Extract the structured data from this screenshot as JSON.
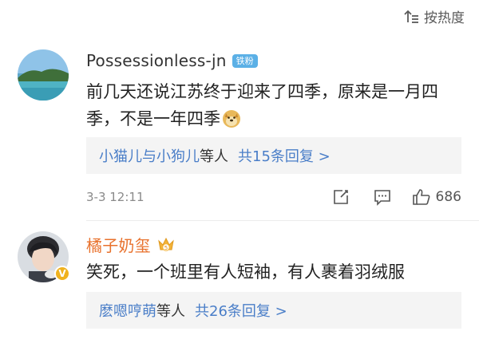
{
  "sort": {
    "label": "按热度",
    "icon": "sort-icon"
  },
  "comments": [
    {
      "username": "Possessionless-jn",
      "badge": "铁粉",
      "text": "前几天还说江苏终于迎来了四季，原来是一月四季，不是一年四季",
      "emoji": "doge-emoji",
      "replies": {
        "users": "小猫儿与小狗儿",
        "suffix": "等人",
        "count": "共15条回复 >"
      },
      "time": "3-3 12:11",
      "likes": "686"
    },
    {
      "username": "橘子奶玺",
      "badge_level": "5",
      "text": "笑死，一个班里有人短袖，有人裹着羽绒服",
      "replies": {
        "users": "麽嗯哼萌",
        "suffix": "等人",
        "count": "共26条回复 >"
      }
    }
  ],
  "colors": {
    "link": "#4a7ec8",
    "vip_name": "#e8712c",
    "fan_badge": "#5bb0e6"
  }
}
